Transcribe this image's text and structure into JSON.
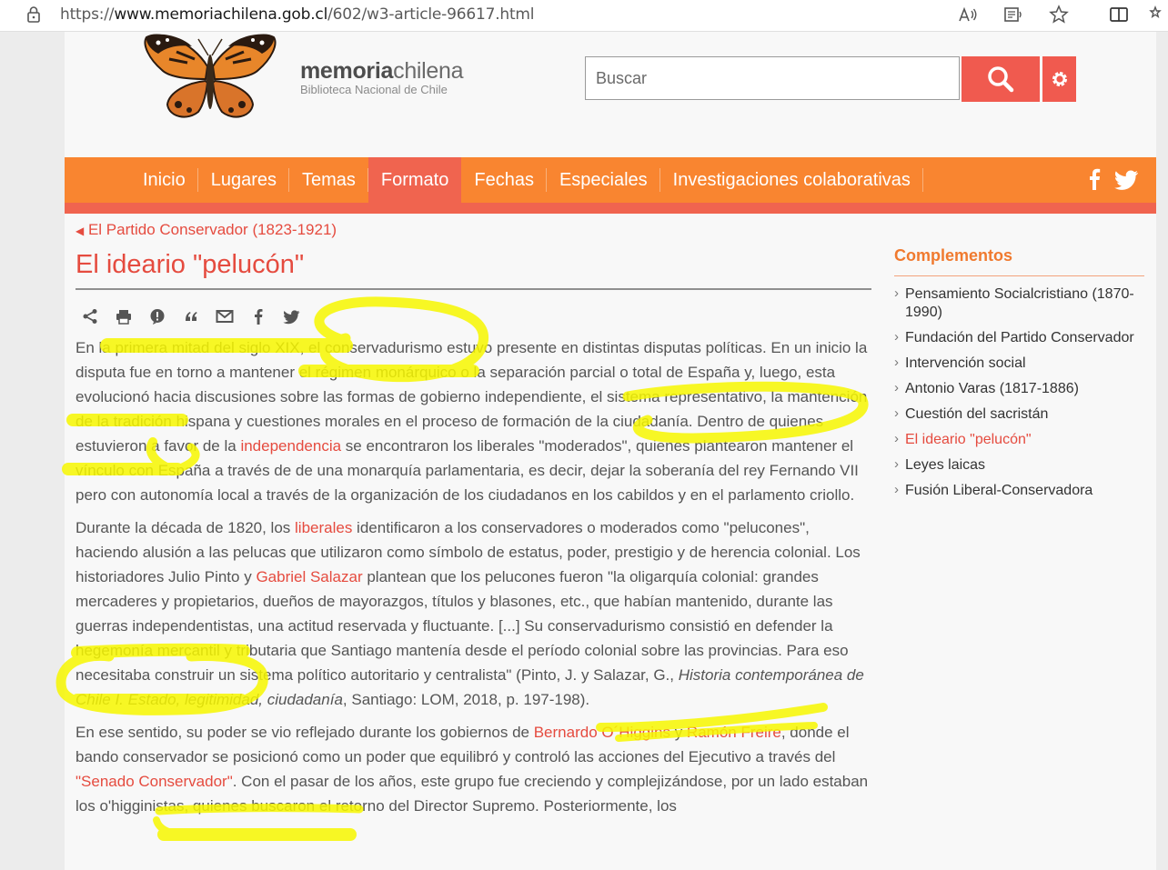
{
  "browser": {
    "url_prefix": "https://",
    "url_host": "www.memoriachilena.gob.cl",
    "url_path": "/602/w3-article-96617.html"
  },
  "brand": {
    "name_bold": "memoria",
    "name_light": "chilena",
    "subtitle": "Biblioteca Nacional de Chile"
  },
  "search": {
    "placeholder": "Buscar"
  },
  "nav": {
    "items": [
      "Inicio",
      "Lugares",
      "Temas",
      "Formato",
      "Fechas",
      "Especiales",
      "Investigaciones colaborativas"
    ],
    "active": "Formato"
  },
  "breadcrumb": "El Partido Conservador (1823-1921)",
  "title": "El ideario \"pelucón\"",
  "article": {
    "p1": {
      "a": "En la primera mitad del siglo XIX, el conservadurismo estuvo presente en distintas disputas políticas. En un inicio la disputa fue en torno a mantener el régimen monárquico o la separación parcial o total de España y, luego, esta evolucionó hacia discusiones sobre las formas de gobierno independiente, el sistema representativo, la mantención de la tradición hispana y cuestiones morales en el proceso de formación de la ciudadanía. Dentro de quienes estuvieron a favor de la ",
      "link1": "independencia",
      "b": " se encontraron los liberales \"moderados\", quienes plantearon mantener el vínculo con España a través de de una monarquía parlamentaria, es decir, dejar la soberanía del rey Fernando VII pero con autonomía local a través de la organización de los ciudadanos en los cabildos y en el parlamento criollo."
    },
    "p2": {
      "a": "Durante la década de 1820, los ",
      "link1": "liberales",
      "b": " identificaron a los conservadores o moderados como \"pelucones\", haciendo alusión a las pelucas que utilizaron como símbolo de estatus, poder, prestigio y de herencia colonial. Los historiadores Julio Pinto y ",
      "link2": "Gabriel Salazar",
      "c": " plantean que los pelucones fueron \"la oligarquía colonial: grandes mercaderes y propietarios, dueños de mayorazgos, títulos y blasones, etc., que habían mantenido, durante las guerras independentistas, una actitud reservada y fluctuante. [...] Su conservadurismo consistió en defender la hegemonía mercantil y tributaria que Santiago mantenía desde el período colonial sobre las provincias. Para eso necesitaba construir un sistema político autoritario y centralista\" (Pinto, J. y Salazar, G., ",
      "italic": "Historia contemporánea de Chile I. Estado, legitimidad, ciudadanía",
      "d": ", Santiago: LOM, 2018, p. 197-198)."
    },
    "p3": {
      "a": "En ese sentido, su poder se vio reflejado durante los gobiernos de ",
      "link1": "Bernardo O´Higgins",
      "b": " y ",
      "link2": "Ramón Freire",
      "c": ", donde el bando conservador se posicionó como un poder que equilibró y controló las acciones del Ejecutivo a través del ",
      "link3": "\"Senado Conservador\"",
      "d": ". Con el pasar de los años, este grupo fue creciendo y complejizándose, por un lado estaban los o'higginistas, quienes buscaron el retorno del Director Supremo. Posteriormente, los"
    }
  },
  "sidebar": {
    "title": "Complementos",
    "items": [
      "Pensamiento Socialcristiano (1870-1990)",
      "Fundación del Partido Conservador",
      "Intervención social",
      "Antonio Varas (1817-1886)",
      "Cuestión del sacristán",
      "El ideario \"pelucón\"",
      "Leyes laicas",
      "Fusión Liberal-Conservadora"
    ]
  },
  "colors": {
    "accent": "#e54b3f",
    "nav": "#f98530",
    "highlight": "#f7f700"
  }
}
